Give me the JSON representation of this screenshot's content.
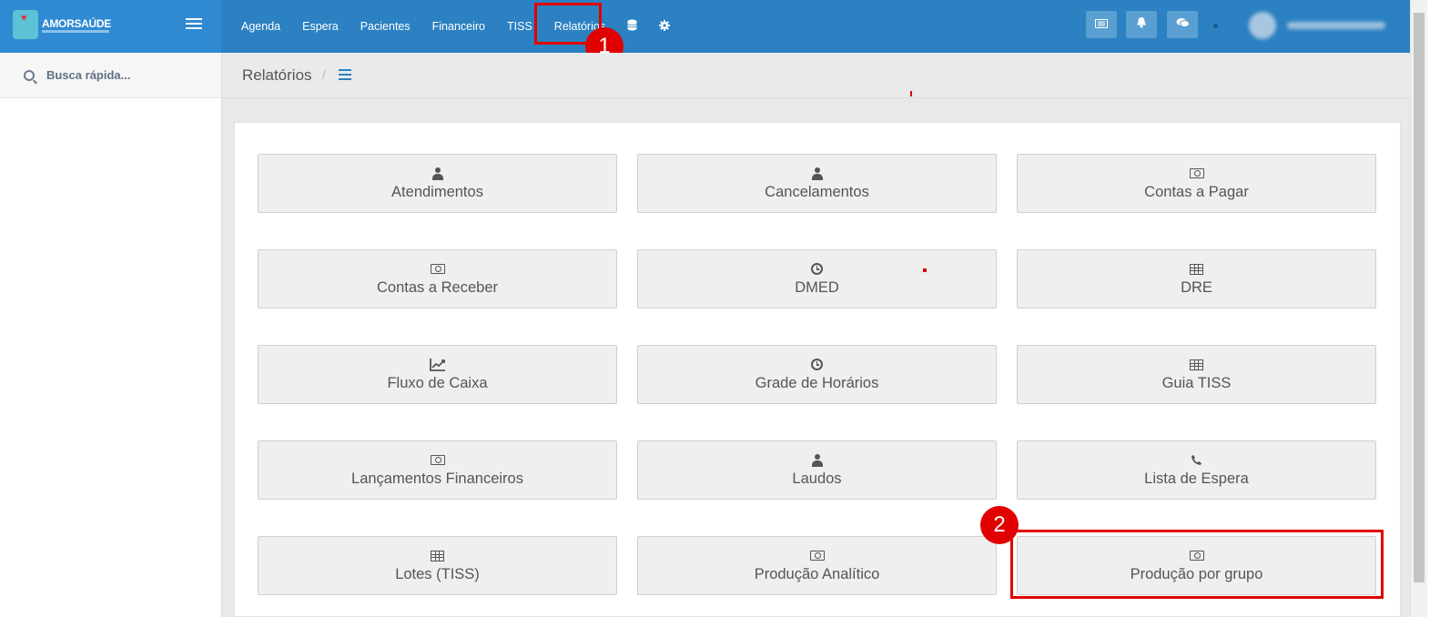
{
  "app": {
    "brand": "AMORSAÚDE"
  },
  "nav": {
    "items": [
      {
        "label": "Agenda"
      },
      {
        "label": "Espera"
      },
      {
        "label": "Pacientes"
      },
      {
        "label": "Financeiro"
      },
      {
        "label": "TISS"
      },
      {
        "label": "Relatórios"
      }
    ],
    "icons": [
      "database-icon",
      "gear-icon"
    ]
  },
  "toolbar": {
    "icons": [
      "list-card-icon",
      "bell-icon",
      "chat-icon"
    ]
  },
  "sidebar": {
    "search_placeholder": "Busca rápida..."
  },
  "breadcrumb": {
    "title": "Relatórios",
    "separator": "/"
  },
  "annotations": {
    "badge1": "1",
    "badge2": "2",
    "highlight_color": "#e10000"
  },
  "reports": [
    {
      "label": "Atendimentos",
      "icon": "doctor-icon"
    },
    {
      "label": "Cancelamentos",
      "icon": "doctor-icon"
    },
    {
      "label": "Contas a Pagar",
      "icon": "money-icon"
    },
    {
      "label": "Contas a Receber",
      "icon": "money-icon"
    },
    {
      "label": "DMED",
      "icon": "clock-icon"
    },
    {
      "label": "DRE",
      "icon": "table-icon"
    },
    {
      "label": "Fluxo de Caixa",
      "icon": "chart-icon"
    },
    {
      "label": "Grade de Horários",
      "icon": "clock-icon"
    },
    {
      "label": "Guia TISS",
      "icon": "table-icon"
    },
    {
      "label": "Lançamentos Financeiros",
      "icon": "money-icon"
    },
    {
      "label": "Laudos",
      "icon": "doctor-icon"
    },
    {
      "label": "Lista de Espera",
      "icon": "phone-icon"
    },
    {
      "label": "Lotes (TISS)",
      "icon": "table-icon"
    },
    {
      "label": "Produção Analítico",
      "icon": "money-icon"
    },
    {
      "label": "Produção por grupo",
      "icon": "money-icon"
    }
  ],
  "colors": {
    "topbar": "#2b81c1",
    "brand_bg": "#2f8ad2",
    "tile_bg": "#efefef"
  }
}
